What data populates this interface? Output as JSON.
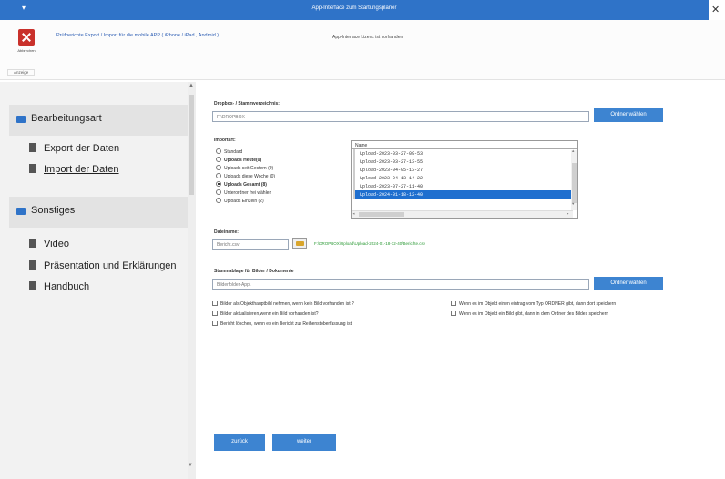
{
  "window": {
    "title": "App-Interface zum Startungsplaner",
    "menu_glyph": "▾",
    "close_glyph": "✕"
  },
  "ribbon": {
    "close_label": "Abbrechen",
    "group_label": "Anzeige",
    "heading": "Prüfberichte Export / Import für die mobile APP ( iPhone / iPad , Android )",
    "status": "App-Interface Lizenz ist vorhanden"
  },
  "sidebar": {
    "scroll_up_glyph": "▲",
    "scroll_down_glyph": "▼",
    "sections": [
      {
        "label": "Bearbeitungsart",
        "items": [
          {
            "label": "Export der Daten",
            "active": false
          },
          {
            "label": "Import der Daten",
            "active": true
          }
        ]
      },
      {
        "label": "Sonstiges",
        "items": [
          {
            "label": "Video",
            "active": false
          },
          {
            "label": "Präsentation und Erklärungen",
            "active": false
          },
          {
            "label": "Handbuch",
            "active": false
          }
        ]
      }
    ]
  },
  "main": {
    "dropbox": {
      "label": "Dropbox- / Stammverzeichnis:",
      "value": "F:\\DROPBOX",
      "button": "Ordner wählen"
    },
    "importart": {
      "label": "Importart:",
      "options": [
        {
          "label": "Standard",
          "selected": false,
          "bold": false
        },
        {
          "label": "Uploads Heute(0)",
          "selected": false,
          "bold": true
        },
        {
          "label": "Uploads seit Gestern (0)",
          "selected": false,
          "bold": false
        },
        {
          "label": "Uploads diese Woche (0)",
          "selected": false,
          "bold": false
        },
        {
          "label": "Uploads Gesamt (8)",
          "selected": true,
          "bold": true
        },
        {
          "label": "Unterordner frei wählen",
          "selected": false,
          "bold": false
        },
        {
          "label": "Uploads Einzeln (2)",
          "selected": false,
          "bold": false
        }
      ]
    },
    "filelist": {
      "header": "Name",
      "rows": [
        {
          "name": "Upload-2023-03-27-09-53",
          "selected": false
        },
        {
          "name": "Upload-2023-03-27-13-55",
          "selected": false
        },
        {
          "name": "Upload-2023-04-05-13-27",
          "selected": false
        },
        {
          "name": "Upload-2023-04-13-14-22",
          "selected": false
        },
        {
          "name": "Upload-2023-07-27-11-40",
          "selected": false
        },
        {
          "name": "Upload-2024-01-18-12-40",
          "selected": true
        }
      ],
      "scroll_up_glyph": "▲",
      "scroll_down_glyph": "▼",
      "scroll_left_glyph": "◂",
      "scroll_right_glyph": "▸"
    },
    "dateiname": {
      "label": "Dateiname:",
      "placeholder": "Bericht.csv",
      "path": "F:\\DROPBOX\\Upload\\Upload-2024-01-18-12-40\\Berichte.csv"
    },
    "stammablage": {
      "label": "Stammablage für Bilder / Dokumente",
      "value": "Bilderfolder-App\\",
      "button": "Ordner wählen"
    },
    "checkboxes_left": [
      "Bilder als Objekthauptbild  nehmen, wenn kein Bild vorhanden ist ?",
      "Bilder aktualisieren,wenn ein Bild vorhanden ist?",
      "Bericht löschen, wenn es ein Bericht zur Reihenstoberfassung ist"
    ],
    "checkboxes_right": [
      "Wenn es im Objekt einen eintrag vom Typ ORDNER gibt, dann dort speichern",
      "Wenn es im Objekt ein Bild gibt, dann in dem Ordner des Bildes speichern"
    ],
    "back_button": "zurück",
    "next_button": "weiter"
  }
}
